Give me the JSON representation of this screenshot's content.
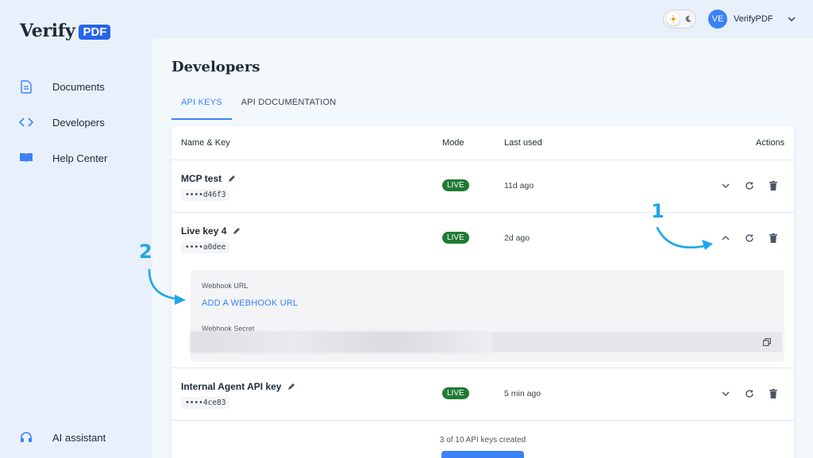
{
  "app": {
    "logo_text": "Verify",
    "logo_badge": "PDF"
  },
  "sidebar": {
    "items": [
      {
        "label": "Documents",
        "icon": "document-icon"
      },
      {
        "label": "Developers",
        "icon": "code-icon"
      },
      {
        "label": "Help Center",
        "icon": "book-icon"
      }
    ],
    "assistant": {
      "label": "AI assistant",
      "icon": "headset-icon"
    }
  },
  "topbar": {
    "avatar_initials": "VE",
    "user_name": "VerifyPDF"
  },
  "page": {
    "title": "Developers",
    "tabs": [
      {
        "label": "API KEYS",
        "active": true
      },
      {
        "label": "API DOCUMENTATION",
        "active": false
      }
    ]
  },
  "table": {
    "headers": {
      "name_key": "Name & Key",
      "mode": "Mode",
      "last_used": "Last used",
      "actions": "Actions"
    },
    "rows": [
      {
        "name": "MCP test",
        "key": "••••d46f3",
        "mode": "LIVE",
        "last_used": "11d ago",
        "expanded": false
      },
      {
        "name": "Live key 4",
        "key": "••••a0dee",
        "mode": "LIVE",
        "last_used": "2d ago",
        "expanded": true
      },
      {
        "name": "Internal Agent API key",
        "key": "••••4ce83",
        "mode": "LIVE",
        "last_used": "5 min ago",
        "expanded": false
      }
    ],
    "expanded_panel": {
      "webhook_url_label": "Webhook URL",
      "add_webhook_link": "ADD A WEBHOOK URL",
      "webhook_secret_label": "Webhook Secret"
    },
    "footer_count": "3 of 10 API keys created"
  },
  "annotations": {
    "marker_1": "1",
    "marker_2": "2"
  },
  "colors": {
    "accent": "#3b82f6",
    "live_badge": "#1f7a35",
    "annotation": "#1ea7e8"
  }
}
